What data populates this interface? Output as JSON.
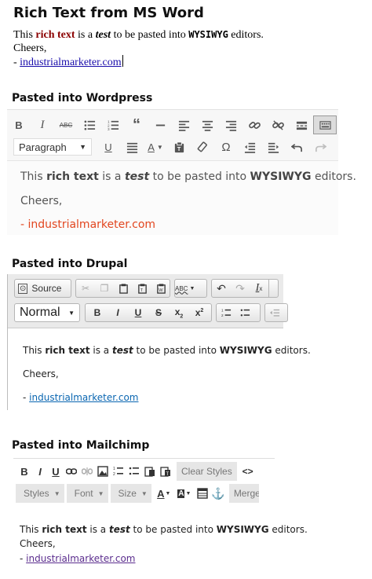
{
  "title": "Rich Text from MS Word",
  "message": {
    "this": "This ",
    "rich_text": "rich text",
    "is_a": " is a ",
    "test": "test",
    "to_be": " to be pasted into ",
    "wysiwyg": "WYSIWYG",
    "editors": " editors.",
    "cheers": "Cheers,",
    "dash": "- ",
    "link": "industrialmarketer.com"
  },
  "wordpress": {
    "heading": "Pasted into Wordpress",
    "format_select": "Paragraph",
    "icons_row1": [
      "bold-icon",
      "italic-icon",
      "strikethrough-icon",
      "bullet-list-icon",
      "numbered-list-icon",
      "blockquote-icon",
      "horizontal-rule-icon",
      "align-left-icon",
      "align-center-icon",
      "align-right-icon",
      "link-icon",
      "unlink-icon",
      "read-more-icon",
      "toolbar-toggle-icon"
    ],
    "icons_row2": [
      "underline-icon",
      "justify-icon",
      "text-color-icon",
      "paste-as-text-icon",
      "clear-formatting-icon",
      "special-character-icon",
      "outdent-icon",
      "indent-icon",
      "undo-icon",
      "redo-icon"
    ],
    "link_color": "#e2461f"
  },
  "drupal": {
    "heading": "Pasted into Drupal",
    "source_label": "Source",
    "format_select": "Normal",
    "link_color": "#0a66b1"
  },
  "mailchimp": {
    "heading": "Pasted into Mailchimp",
    "clear_styles": "Clear Styles",
    "styles": "Styles",
    "font": "Font",
    "size": "Size",
    "merge": "Merge T",
    "link_color": "#5b2d8e"
  }
}
